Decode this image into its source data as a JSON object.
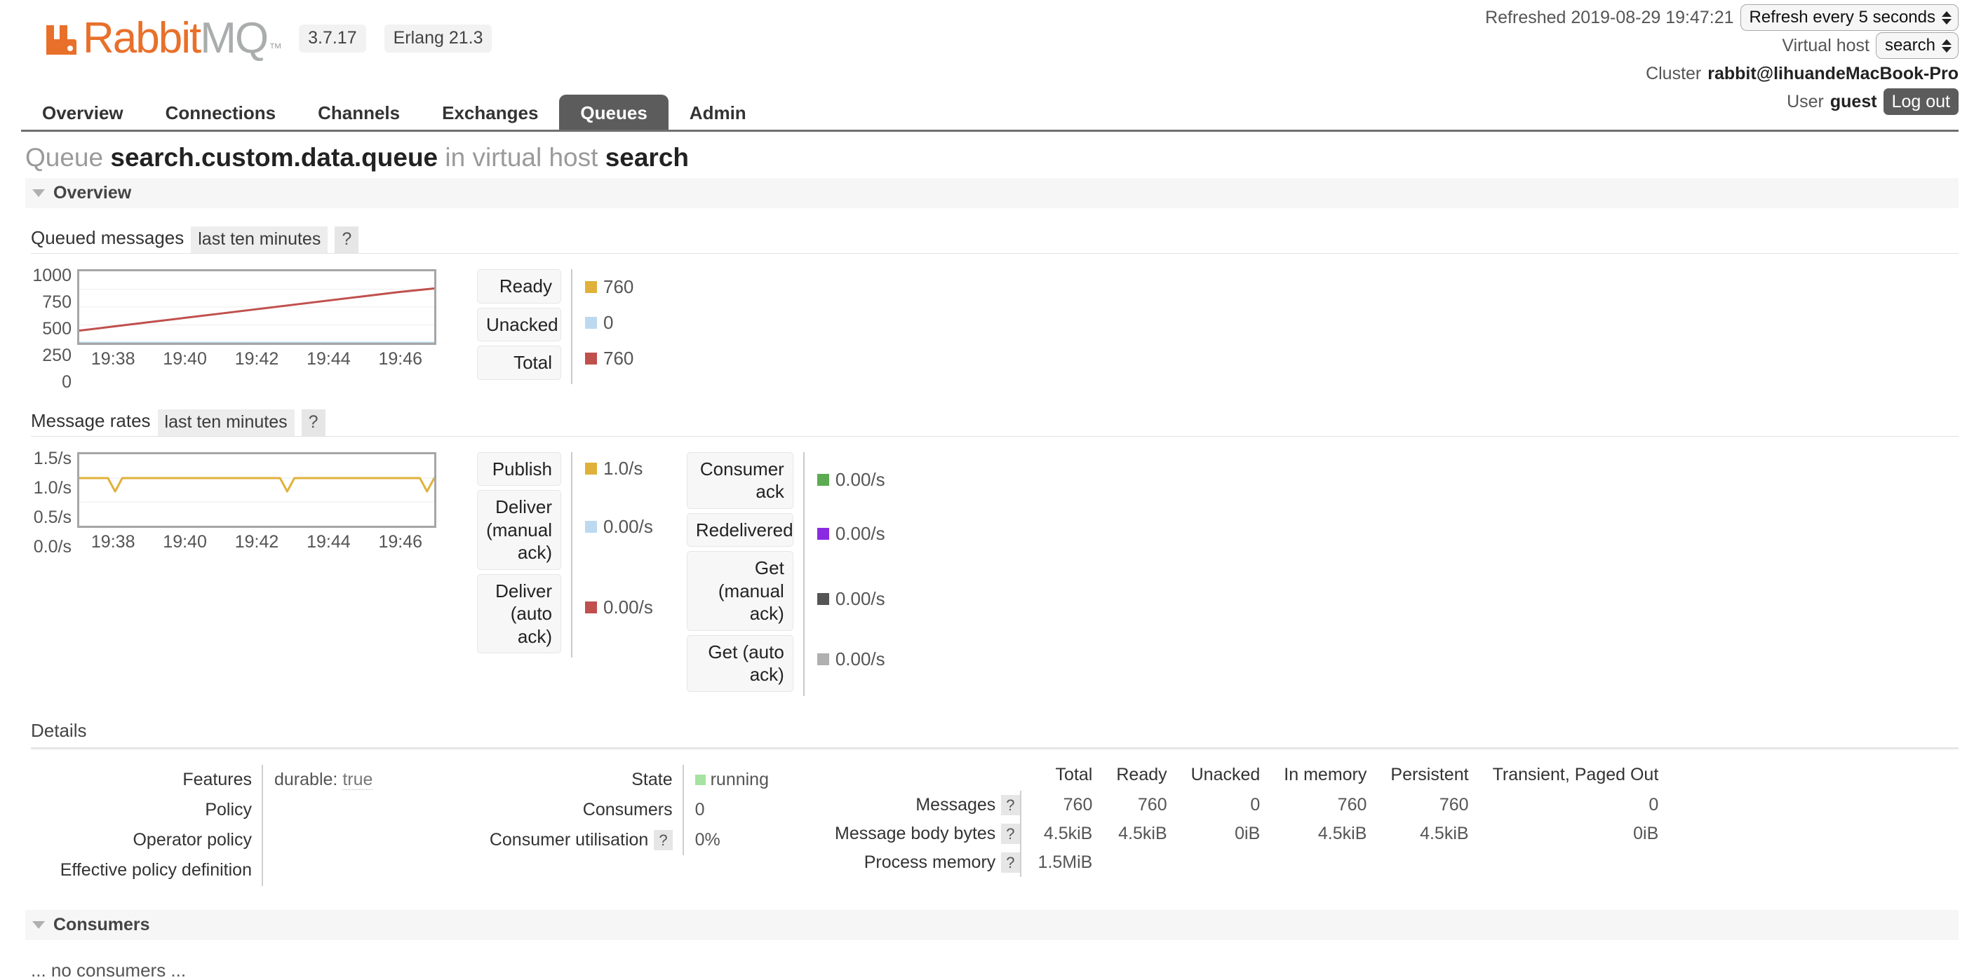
{
  "header": {
    "logo": {
      "rabbit": "Rabbit",
      "mq": "MQ",
      "tm": "™"
    },
    "version": "3.7.17",
    "erlang": "Erlang 21.3",
    "refreshed_label": "Refreshed 2019-08-29 19:47:21",
    "refresh_select": "Refresh every 5 seconds",
    "vhost_label": "Virtual host",
    "vhost_select": "search",
    "cluster_label": "Cluster",
    "cluster_name": "rabbit@lihuandeMacBook-Pro",
    "user_label": "User",
    "user_name": "guest",
    "logout": "Log out"
  },
  "nav": {
    "tabs": [
      {
        "label": "Overview",
        "active": false
      },
      {
        "label": "Connections",
        "active": false
      },
      {
        "label": "Channels",
        "active": false
      },
      {
        "label": "Exchanges",
        "active": false
      },
      {
        "label": "Queues",
        "active": true
      },
      {
        "label": "Admin",
        "active": false
      }
    ]
  },
  "page": {
    "title_prefix": "Queue",
    "queue_name": "search.custom.data.queue",
    "title_mid": "in virtual host",
    "vhost": "search"
  },
  "sections": {
    "overview": "Overview",
    "consumers": "Consumers",
    "details": "Details",
    "no_consumers": "... no consumers ..."
  },
  "queued": {
    "title": "Queued messages",
    "range": "last ten minutes",
    "help": "?",
    "legend": [
      {
        "label": "Ready",
        "value": "760",
        "color": "#e0b13a"
      },
      {
        "label": "Unacked",
        "value": "0",
        "color": "#bcd9f0"
      },
      {
        "label": "Total",
        "value": "760",
        "color": "#c0504d"
      }
    ]
  },
  "rates": {
    "title": "Message rates",
    "range": "last ten minutes",
    "help": "?",
    "legend_left": [
      {
        "label": "Publish",
        "value": "1.0/s",
        "color": "#e0b13a"
      },
      {
        "label": "Deliver (manual ack)",
        "value": "0.00/s",
        "color": "#bcd9f0"
      },
      {
        "label": "Deliver (auto ack)",
        "value": "0.00/s",
        "color": "#c0504d"
      }
    ],
    "legend_right": [
      {
        "label": "Consumer ack",
        "value": "0.00/s",
        "color": "#5ca košice"
      },
      {
        "label": "Redelivered",
        "value": "0.00/s",
        "color": "#8a2be2"
      },
      {
        "label": "Get (manual ack)",
        "value": "0.00/s",
        "color": "#555555"
      },
      {
        "label": "Get (auto ack)",
        "value": "0.00/s",
        "color": "#b0b0b0"
      }
    ]
  },
  "details": {
    "left_rows": [
      {
        "key": "Features",
        "value": "durable: true",
        "value_prefix": "durable:",
        "value_dotted": "true"
      },
      {
        "key": "Policy",
        "value": ""
      },
      {
        "key": "Operator policy",
        "value": ""
      },
      {
        "key": "Effective policy definition",
        "value": ""
      }
    ],
    "mid_rows": [
      {
        "key": "State",
        "value": "running",
        "has_square": true
      },
      {
        "key": "Consumers",
        "value": "0",
        "has_square": false
      },
      {
        "key": "Consumer utilisation",
        "value": "0%",
        "has_square": false,
        "help": "?"
      }
    ],
    "stats": {
      "columns": [
        "Total",
        "Ready",
        "Unacked",
        "In memory",
        "Persistent",
        "Transient, Paged Out"
      ],
      "rows": [
        {
          "label": "Messages",
          "help": "?",
          "values": [
            "760",
            "760",
            "0",
            "760",
            "760",
            "0"
          ]
        },
        {
          "label": "Message body bytes",
          "help": "?",
          "values": [
            "4.5kiB",
            "4.5kiB",
            "0iB",
            "4.5kiB",
            "4.5kiB",
            "0iB"
          ]
        },
        {
          "label": "Process memory",
          "help": "?",
          "values": [
            "1.5MiB",
            "",
            "",
            "",
            "",
            ""
          ]
        }
      ]
    }
  },
  "chart_data": [
    {
      "type": "line",
      "title": "Queued messages",
      "subtitle": "last ten minutes",
      "xlabel": "",
      "ylabel": "",
      "ylim": [
        0,
        1000
      ],
      "yticks": [
        1000,
        750,
        500,
        250,
        0
      ],
      "xticks": [
        "19:38",
        "19:40",
        "19:42",
        "19:44",
        "19:46"
      ],
      "grid": true,
      "legend_position": "right",
      "series": [
        {
          "name": "Total",
          "color": "#c0504d",
          "x": [
            0,
            1,
            2,
            3,
            4,
            5,
            6,
            7,
            8,
            9,
            10
          ],
          "values": [
            170,
            230,
            290,
            350,
            410,
            470,
            530,
            590,
            650,
            710,
            760
          ]
        },
        {
          "name": "Unacked",
          "color": "#bcd9f0",
          "x": [
            0,
            1,
            2,
            3,
            4,
            5,
            6,
            7,
            8,
            9,
            10
          ],
          "values": [
            0,
            0,
            0,
            0,
            0,
            0,
            0,
            0,
            0,
            0,
            0
          ]
        }
      ]
    },
    {
      "type": "line",
      "title": "Message rates",
      "subtitle": "last ten minutes",
      "xlabel": "",
      "ylabel": "",
      "ylim": [
        0,
        1.5
      ],
      "yticks": [
        "1.5/s",
        "1.0/s",
        "0.5/s",
        "0.0/s"
      ],
      "xticks": [
        "19:38",
        "19:40",
        "19:42",
        "19:44",
        "19:46"
      ],
      "grid": true,
      "legend_position": "right",
      "series": [
        {
          "name": "Publish",
          "color": "#e0b13a",
          "x": [
            0,
            0.8,
            1.0,
            1.2,
            2,
            3,
            4,
            5,
            5.6,
            5.8,
            6.0,
            7,
            8,
            9,
            9.5,
            9.7,
            9.9
          ],
          "values": [
            1.0,
            1.0,
            0.72,
            1.0,
            1.0,
            1.0,
            1.0,
            1.0,
            1.0,
            0.72,
            1.0,
            1.0,
            1.0,
            1.0,
            1.0,
            0.72,
            1.0
          ]
        }
      ]
    }
  ]
}
